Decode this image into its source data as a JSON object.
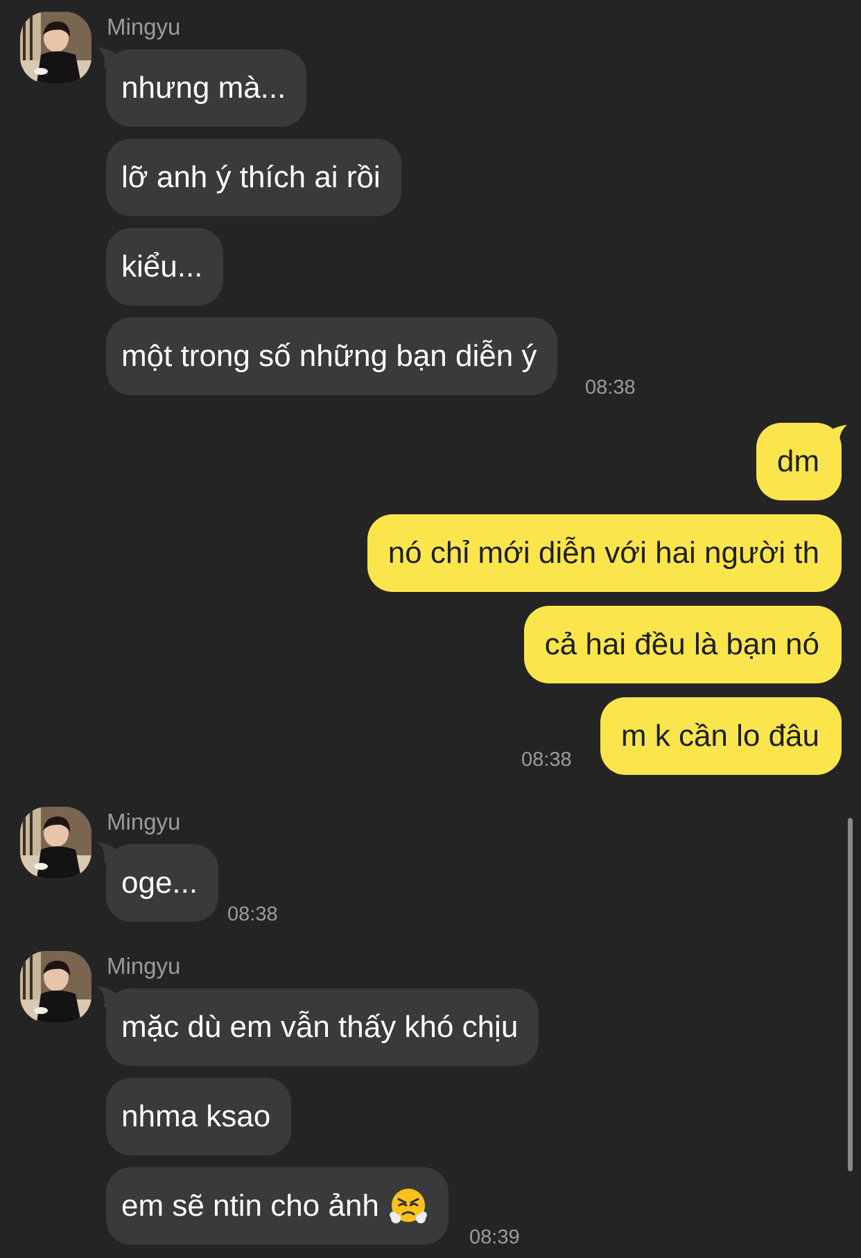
{
  "colors": {
    "background": "#242424",
    "incoming_bubble": "#3a3a3c",
    "outgoing_bubble": "#fae64c",
    "meta_text": "#9b9b9b"
  },
  "groups": [
    {
      "sender": "Mingyu",
      "avatar_icon": "profile-photo-icon",
      "messages": [
        "nhưng mà...",
        "lỡ anh ý thích ai rồi",
        "kiểu...",
        "một trong số những bạn diễn ý"
      ],
      "time": "08:38"
    },
    {
      "sender": "me",
      "messages": [
        "dm",
        "nó chỉ mới diễn với hai người th",
        "cả hai đều là bạn nó",
        "m k cần lo đâu"
      ],
      "time": "08:38"
    },
    {
      "sender": "Mingyu",
      "avatar_icon": "profile-photo-icon",
      "messages": [
        "oge..."
      ],
      "time": "08:38"
    },
    {
      "sender": "Mingyu",
      "avatar_icon": "profile-photo-icon",
      "messages": [
        "mặc dù em vẫn thấy khó chịu",
        "nhma ksao",
        "em sẽ ntin cho ảnh"
      ],
      "last_message_emoji": "face-with-steam-from-nose-icon",
      "time": "08:39"
    }
  ]
}
